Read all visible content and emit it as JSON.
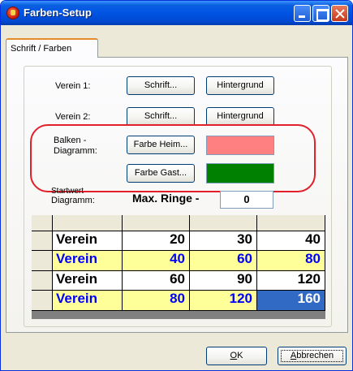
{
  "window": {
    "title": "Farben-Setup"
  },
  "tabs": [
    {
      "label": "Schrift / Farben"
    }
  ],
  "verein1": {
    "label": "Verein 1:",
    "schrift_button": "Schrift...",
    "hintergrund_button": "Hintergrund"
  },
  "verein2": {
    "label": "Verein 2:",
    "schrift_button": "Schrift...",
    "hintergrund_button": "Hintergrund"
  },
  "balken": {
    "label_line1": "Balken -",
    "label_line2": "Diagramm:",
    "farbe_heim_button": "Farbe Heim...",
    "farbe_gast_button": "Farbe Gast...",
    "farbe_heim_color": "#ff8080",
    "farbe_gast_color": "#008000"
  },
  "startwert": {
    "label_line1": "Startwert",
    "label_line2": "Diagramm:",
    "max_label": "Max. Ringe -",
    "max_value": "0"
  },
  "grid": {
    "rows": [
      {
        "name": "Verein",
        "values": [
          "20",
          "30",
          "40"
        ],
        "style": "black"
      },
      {
        "name": "Verein",
        "values": [
          "40",
          "60",
          "80"
        ],
        "style": "blue"
      },
      {
        "name": "Verein",
        "values": [
          "60",
          "90",
          "120"
        ],
        "style": "black"
      },
      {
        "name": "Verein",
        "values": [
          "80",
          "120",
          "160"
        ],
        "style": "blue"
      }
    ],
    "selected_cell_value": "160"
  },
  "footer": {
    "ok_mnemonic": "O",
    "ok_rest": "K",
    "cancel_mnemonic": "A",
    "cancel_rest": "bbrechen"
  },
  "colors": {
    "titlebar": "#0054e3",
    "highlight_ring": "#e0202a",
    "selected_cell": "#316ac5",
    "alt_row": "#ffff99",
    "alt_text": "#0000ff"
  }
}
